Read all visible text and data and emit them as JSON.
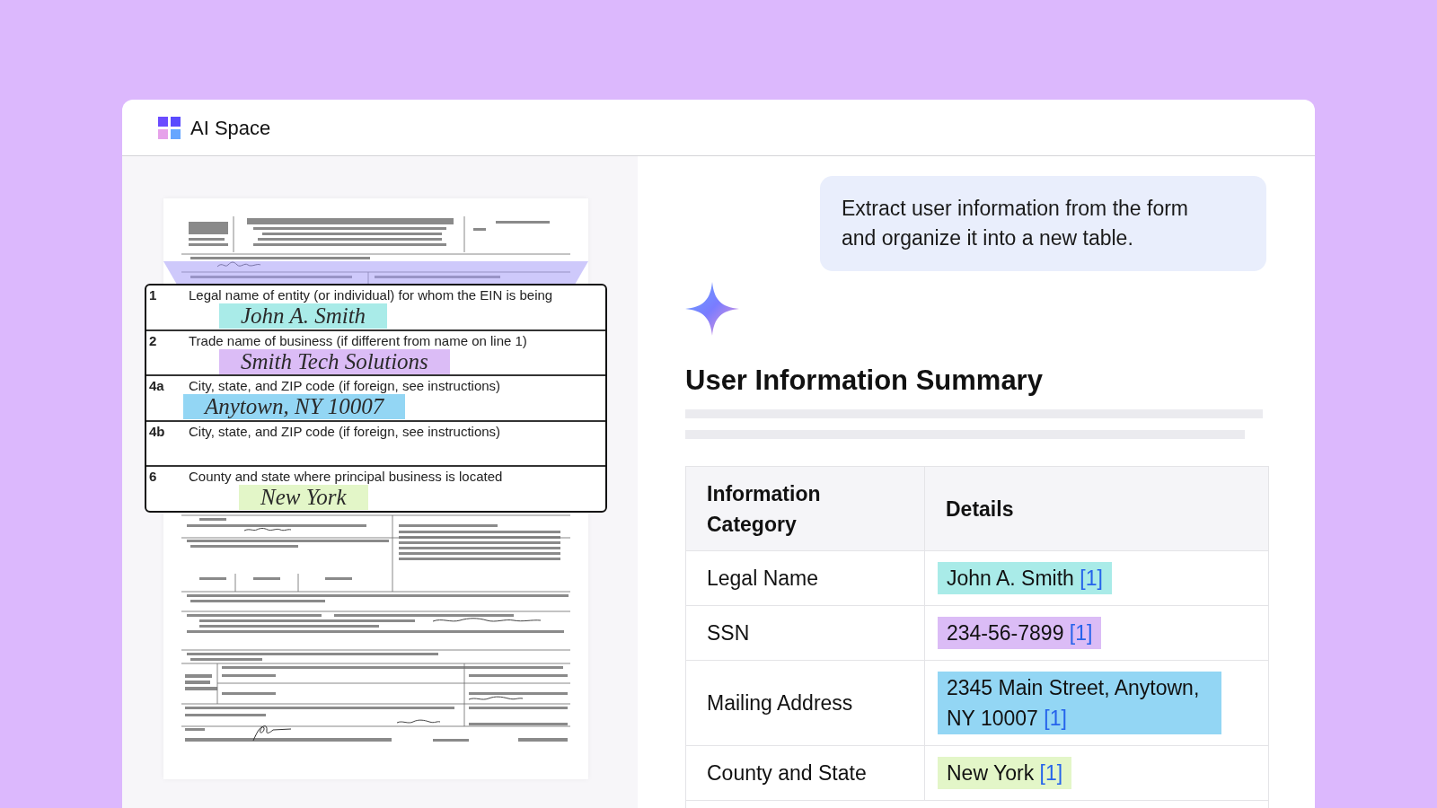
{
  "app": {
    "name": "AI Space"
  },
  "magnifier": {
    "rows": [
      {
        "number": "1",
        "label": "Legal name of entity (or individual) for whom the EIN is being",
        "handwriting": "John A. Smith",
        "color": "#a9ebe8"
      },
      {
        "number": "2",
        "label": "Trade name of business (if different from name on line 1)",
        "handwriting": "Smith Tech Solutions",
        "color": "#dbbcf6"
      },
      {
        "number": "4a",
        "label": "City, state, and ZIP code (if foreign, see instructions)",
        "handwriting": "Anytown, NY 10007",
        "color": "#93d6f4"
      },
      {
        "number": "4b",
        "label": "City, state, and ZIP code (if foreign, see instructions)"
      },
      {
        "number": "6",
        "label": "County and state where principal business is located",
        "handwriting": "New York",
        "color": "#e3f6c8"
      }
    ]
  },
  "prompt": "Extract user information from the form and organize it into a new table.",
  "answer": {
    "title": "User Information Summary",
    "table": {
      "columns": [
        "Information Category",
        "Details"
      ],
      "rows": [
        {
          "category": "Legal Name",
          "value": "John A. Smith",
          "citation": "[1]",
          "color": "#a9ebe8"
        },
        {
          "category": "SSN",
          "value": "234-56-7899",
          "citation": "[1]",
          "color": "#dbbcf6"
        },
        {
          "category": "Mailing Address",
          "value": "2345 Main Street, Anytown, NY 10007",
          "citation": "[1]",
          "color": "#93d6f4"
        },
        {
          "category": "County and State",
          "value": "New York",
          "citation": "[1]",
          "color": "#e3f6c8"
        }
      ]
    }
  }
}
